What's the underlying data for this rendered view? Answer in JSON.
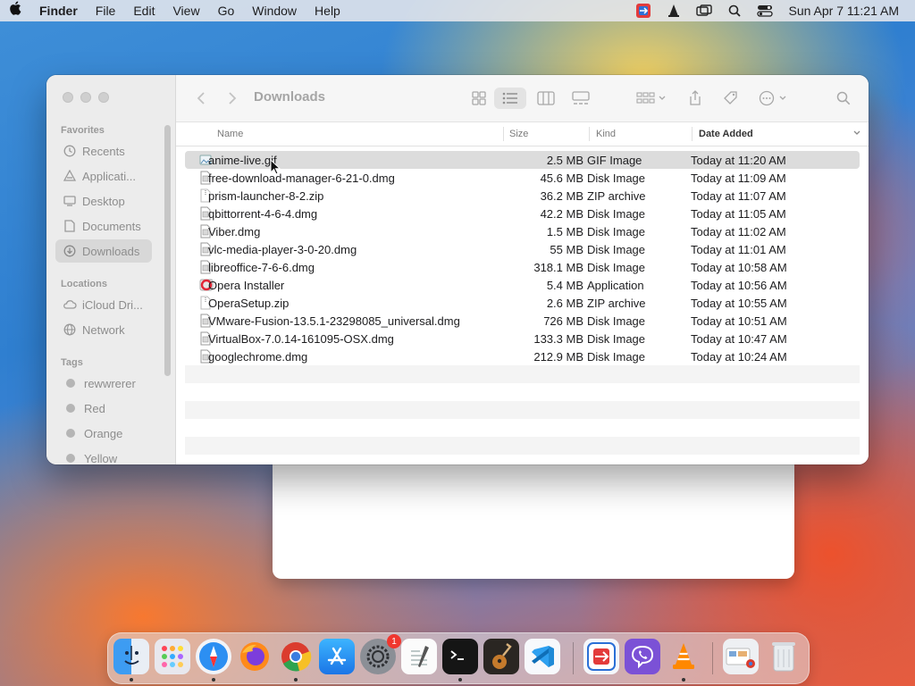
{
  "menubar": {
    "app_name": "Finder",
    "menus": [
      "File",
      "Edit",
      "View",
      "Go",
      "Window",
      "Help"
    ],
    "clock": "Sun Apr 7  11:21 AM"
  },
  "window": {
    "title": "Downloads"
  },
  "sidebar": {
    "favorites_header": "Favorites",
    "favorites": [
      {
        "label": "Recents",
        "icon": "clock-icon"
      },
      {
        "label": "Applicati...",
        "icon": "applications-icon"
      },
      {
        "label": "Desktop",
        "icon": "desktop-icon"
      },
      {
        "label": "Documents",
        "icon": "document-icon"
      },
      {
        "label": "Downloads",
        "icon": "download-icon"
      }
    ],
    "locations_header": "Locations",
    "locations": [
      {
        "label": "iCloud Dri...",
        "icon": "cloud-icon"
      },
      {
        "label": "Network",
        "icon": "globe-icon"
      }
    ],
    "tags_header": "Tags",
    "tags": [
      {
        "label": "rewwrerer"
      },
      {
        "label": "Red"
      },
      {
        "label": "Orange"
      },
      {
        "label": "Yellow"
      }
    ]
  },
  "columns": {
    "name": "Name",
    "size": "Size",
    "kind": "Kind",
    "date_added": "Date Added"
  },
  "files": [
    {
      "name": "anime-live.gif",
      "size": "2.5 MB",
      "kind": "GIF Image",
      "date": "Today at 11:20 AM",
      "icon": "image-file-icon"
    },
    {
      "name": "free-download-manager-6-21-0.dmg",
      "size": "45.6 MB",
      "kind": "Disk Image",
      "date": "Today at 11:09 AM",
      "icon": "disk-image-icon"
    },
    {
      "name": "prism-launcher-8-2.zip",
      "size": "36.2 MB",
      "kind": "ZIP archive",
      "date": "Today at 11:07 AM",
      "icon": "zip-icon"
    },
    {
      "name": "qbittorrent-4-6-4.dmg",
      "size": "42.2 MB",
      "kind": "Disk Image",
      "date": "Today at 11:05 AM",
      "icon": "disk-image-icon"
    },
    {
      "name": "Viber.dmg",
      "size": "1.5 MB",
      "kind": "Disk Image",
      "date": "Today at 11:02 AM",
      "icon": "disk-image-icon"
    },
    {
      "name": "vlc-media-player-3-0-20.dmg",
      "size": "55 MB",
      "kind": "Disk Image",
      "date": "Today at 11:01 AM",
      "icon": "disk-image-icon"
    },
    {
      "name": "libreoffice-7-6-6.dmg",
      "size": "318.1 MB",
      "kind": "Disk Image",
      "date": "Today at 10:58 AM",
      "icon": "disk-image-icon"
    },
    {
      "name": "Opera Installer",
      "size": "5.4 MB",
      "kind": "Application",
      "date": "Today at 10:56 AM",
      "icon": "opera-app-icon"
    },
    {
      "name": "OperaSetup.zip",
      "size": "2.6 MB",
      "kind": "ZIP archive",
      "date": "Today at 10:55 AM",
      "icon": "zip-icon"
    },
    {
      "name": "VMware-Fusion-13.5.1-23298085_universal.dmg",
      "size": "726 MB",
      "kind": "Disk Image",
      "date": "Today at 10:51 AM",
      "icon": "disk-image-icon"
    },
    {
      "name": "VirtualBox-7.0.14-161095-OSX.dmg",
      "size": "133.3 MB",
      "kind": "Disk Image",
      "date": "Today at 10:47 AM",
      "icon": "disk-image-icon"
    },
    {
      "name": "googlechrome.dmg",
      "size": "212.9 MB",
      "kind": "Disk Image",
      "date": "Today at 10:24 AM",
      "icon": "disk-image-icon"
    }
  ],
  "dock": {
    "badge_count": "1",
    "apps": [
      "finder-icon",
      "launchpad-icon",
      "safari-icon",
      "firefox-icon",
      "chrome-icon",
      "app-store-icon",
      "system-settings-icon",
      "textedit-icon",
      "terminal-icon",
      "garageband-icon",
      "vscode-icon",
      "teamviewer-icon",
      "viber-icon",
      "vlc-icon",
      "downloads-stack-icon",
      "trash-icon"
    ]
  }
}
